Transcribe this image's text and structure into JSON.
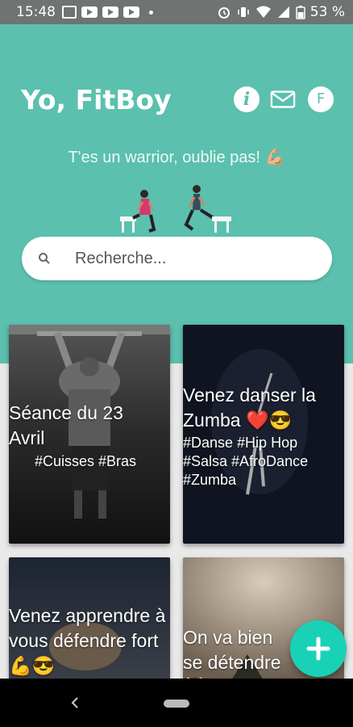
{
  "status_bar": {
    "time": "15:48",
    "battery": "53 %"
  },
  "header": {
    "greeting": "Yo, FitBoy",
    "avatar_letter": "F",
    "motto": "T'es un warrior, oublie pas! 💪🏼"
  },
  "search": {
    "placeholder": "Recherche..."
  },
  "cards": [
    {
      "title": "Séance du 23 Avril",
      "tags": "#Cuisses #Bras"
    },
    {
      "title": "Venez danser la Zumba ❤️😎",
      "tags": "#Danse #Hip Hop #Salsa #AfroDance #Zumba"
    },
    {
      "title": "Venez apprendre à vous défendre fort 💪😎",
      "tags": ""
    },
    {
      "title": "On va bien se détendre 💆",
      "tags": ""
    }
  ],
  "fab": {
    "label": "+"
  },
  "colors": {
    "header": "#5bc0ae",
    "fab": "#19d2b6"
  },
  "icons": [
    "info-icon",
    "mail-icon",
    "search-icon",
    "plus-icon",
    "back-icon",
    "home-icon",
    "alarm-icon",
    "vibrate-icon",
    "wifi-icon",
    "signal-icon",
    "battery-icon",
    "youtube-icon"
  ]
}
